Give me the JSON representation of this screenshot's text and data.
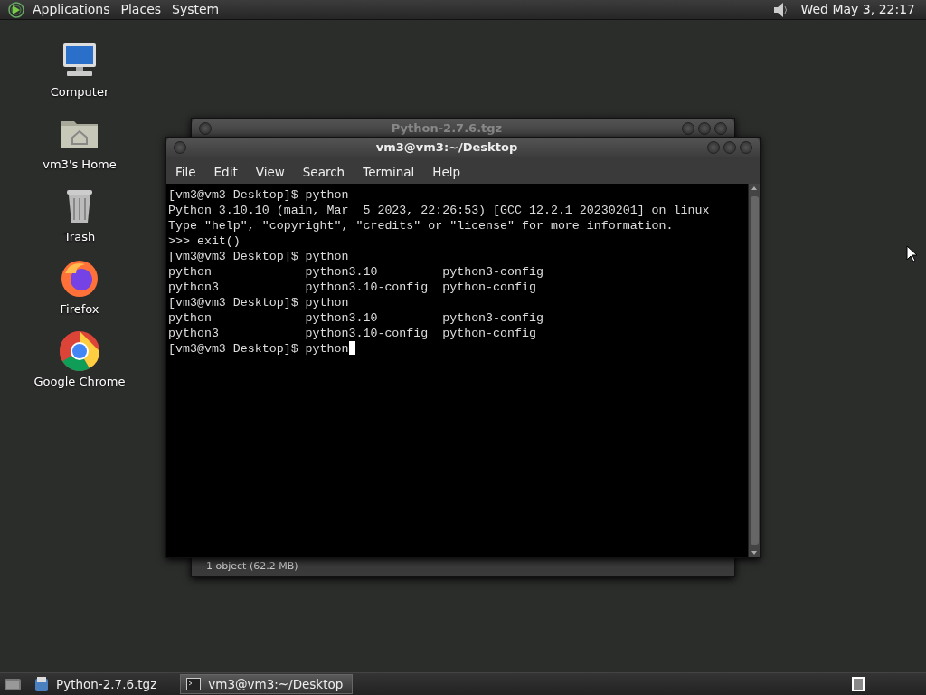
{
  "top_panel": {
    "menus": [
      "Applications",
      "Places",
      "System"
    ],
    "clock": "Wed May  3, 22:17"
  },
  "desktop_icons": [
    {
      "label": "Computer",
      "kind": "computer"
    },
    {
      "label": "vm3's Home",
      "kind": "home"
    },
    {
      "label": "Trash",
      "kind": "trash"
    },
    {
      "label": "Firefox",
      "kind": "firefox"
    },
    {
      "label": "Google Chrome",
      "kind": "chrome"
    }
  ],
  "back_window": {
    "title": "Python-2.7.6.tgz",
    "status": "1 object (62.2 MB)"
  },
  "terminal_window": {
    "title": "vm3@vm3:~/Desktop",
    "menus": [
      "File",
      "Edit",
      "View",
      "Search",
      "Terminal",
      "Help"
    ],
    "lines": [
      "[vm3@vm3 Desktop]$ python",
      "Python 3.10.10 (main, Mar  5 2023, 22:26:53) [GCC 12.2.1 20230201] on linux",
      "Type \"help\", \"copyright\", \"credits\" or \"license\" for more information.",
      ">>> exit()",
      "[vm3@vm3 Desktop]$ python",
      "python             python3.10         python3-config",
      "python3            python3.10-config  python-config",
      "[vm3@vm3 Desktop]$ python",
      "python             python3.10         python3-config",
      "python3            python3.10-config  python-config",
      "[vm3@vm3 Desktop]$ python"
    ],
    "cursor": true
  },
  "taskbar": {
    "items": [
      {
        "label": "Python-2.7.6.tgz",
        "kind": "archive",
        "selected": false
      },
      {
        "label": "vm3@vm3:~/Desktop",
        "kind": "terminal",
        "selected": true
      }
    ]
  }
}
